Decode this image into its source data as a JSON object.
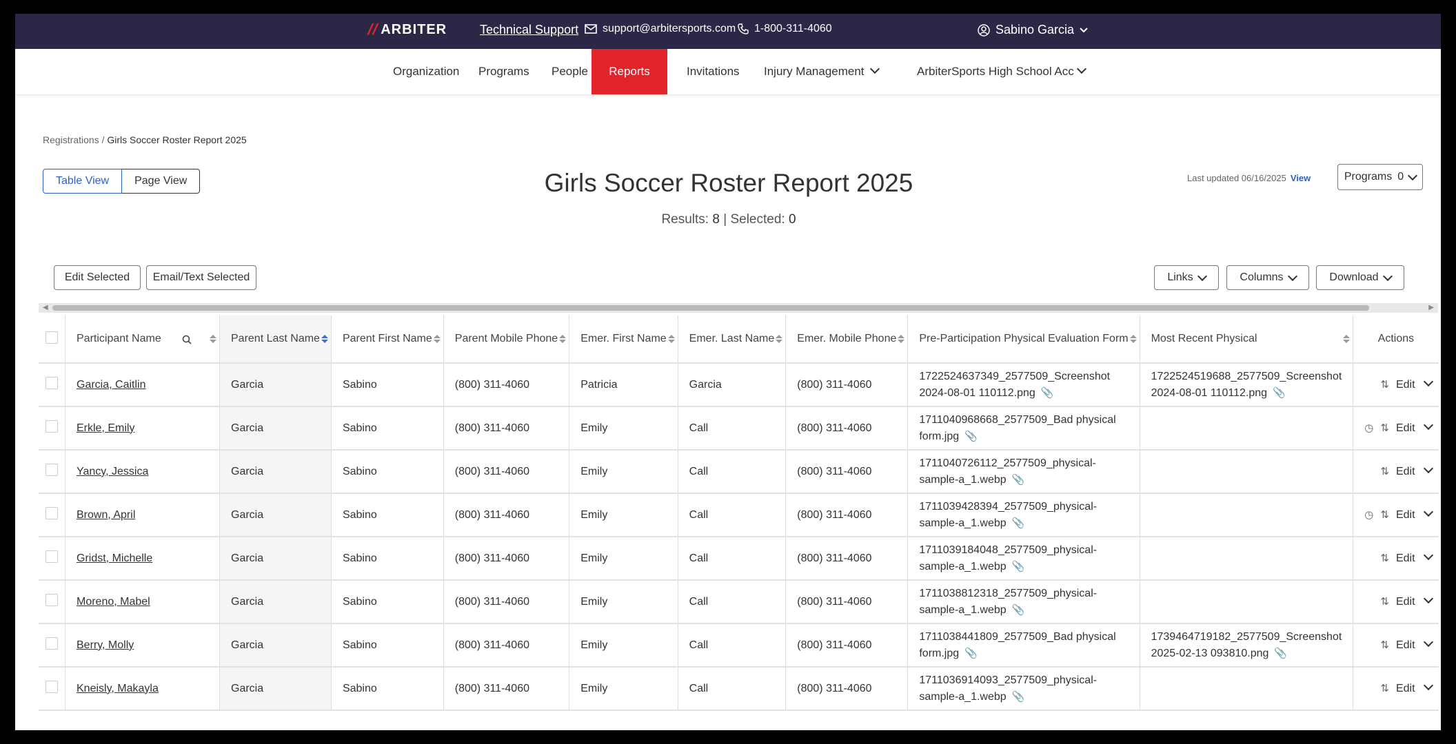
{
  "topbar": {
    "brand": "ARBITER",
    "support_link": "Technical Support",
    "email": "support@arbitersports.com",
    "phone": "1-800-311-4060",
    "user": "Sabino Garcia"
  },
  "nav": {
    "items": [
      "Organization",
      "Programs",
      "People",
      "Reports",
      "Invitations",
      "Injury Management",
      "ArbiterSports High School Acc"
    ],
    "active": "Reports"
  },
  "breadcrumb": {
    "parent": "Registrations",
    "separator": "/",
    "current": "Girls Soccer Roster Report 2025"
  },
  "view_toggle": {
    "table": "Table View",
    "page": "Page View",
    "selected": "Table View"
  },
  "title": "Girls Soccer Roster Report 2025",
  "results": {
    "label": "Results:",
    "count": "8",
    "sep": "|",
    "selected_label": "Selected:",
    "selected_count": "0"
  },
  "last_updated": {
    "text": "Last updated 06/16/2025",
    "link": "View"
  },
  "programs": {
    "label": "Programs",
    "count": "0"
  },
  "toolbar": {
    "edit_selected": "Edit Selected",
    "email_selected": "Email/Text Selected",
    "links": "Links",
    "columns": "Columns",
    "download": "Download"
  },
  "table": {
    "headers": [
      "Participant Name",
      "Parent Last Name",
      "Parent First Name",
      "Parent Mobile Phone",
      "Emer. First Name",
      "Emer. Last Name",
      "Emer. Mobile Phone",
      "Pre-Participation Physical Evaluation Form",
      "Most Recent Physical",
      "Actions"
    ],
    "sorted_column": "Parent Last Name",
    "rows": [
      {
        "name": "Garcia, Caitlin",
        "plast": "Garcia",
        "pfirst": "Sabino",
        "pphone": "(800) 311-4060",
        "efirst": "Patricia",
        "elast": "Garcia",
        "ephone": "(800) 311-4060",
        "ppe_form": "1722524637349_2577509_Screenshot 2024-08-01 110112.png",
        "recent": "1722524519688_2577509_Screenshot 2024-08-01 110112.png",
        "history": false,
        "edit": "Edit"
      },
      {
        "name": "Erkle, Emily",
        "plast": "Garcia",
        "pfirst": "Sabino",
        "pphone": "(800) 311-4060",
        "efirst": "Emily",
        "elast": "Call",
        "ephone": "(800) 311-4060",
        "ppe_form": "1711040968668_2577509_Bad physical form.jpg",
        "recent": "",
        "history": true,
        "edit": "Edit"
      },
      {
        "name": "Yancy, Jessica",
        "plast": "Garcia",
        "pfirst": "Sabino",
        "pphone": "(800) 311-4060",
        "efirst": "Emily",
        "elast": "Call",
        "ephone": "(800) 311-4060",
        "ppe_form": "1711040726112_2577509_physical-sample-a_1.webp",
        "recent": "",
        "history": false,
        "edit": "Edit"
      },
      {
        "name": "Brown, April",
        "plast": "Garcia",
        "pfirst": "Sabino",
        "pphone": "(800) 311-4060",
        "efirst": "Emily",
        "elast": "Call",
        "ephone": "(800) 311-4060",
        "ppe_form": "1711039428394_2577509_physical-sample-a_1.webp",
        "recent": "",
        "history": true,
        "edit": "Edit"
      },
      {
        "name": "Gridst, Michelle",
        "plast": "Garcia",
        "pfirst": "Sabino",
        "pphone": "(800) 311-4060",
        "efirst": "Emily",
        "elast": "Call",
        "ephone": "(800) 311-4060",
        "ppe_form": "1711039184048_2577509_physical-sample-a_1.webp",
        "recent": "",
        "history": false,
        "edit": "Edit"
      },
      {
        "name": "Moreno, Mabel",
        "plast": "Garcia",
        "pfirst": "Sabino",
        "pphone": "(800) 311-4060",
        "efirst": "Emily",
        "elast": "Call",
        "ephone": "(800) 311-4060",
        "ppe_form": "1711038812318_2577509_physical-sample-a_1.webp",
        "recent": "",
        "history": false,
        "edit": "Edit"
      },
      {
        "name": "Berry, Molly",
        "plast": "Garcia",
        "pfirst": "Sabino",
        "pphone": "(800) 311-4060",
        "efirst": "Emily",
        "elast": "Call",
        "ephone": "(800) 311-4060",
        "ppe_form": "1711038441809_2577509_Bad physical form.jpg",
        "recent": "1739464719182_2577509_Screenshot 2025-02-13 093810.png",
        "history": false,
        "edit": "Edit"
      },
      {
        "name": "Kneisly, Makayla",
        "plast": "Garcia",
        "pfirst": "Sabino",
        "pphone": "(800) 311-4060",
        "efirst": "Emily",
        "elast": "Call",
        "ephone": "(800) 311-4060",
        "ppe_form": "1711036914093_2577509_physical-sample-a_1.webp",
        "recent": "",
        "history": false,
        "edit": "Edit"
      }
    ]
  },
  "colors": {
    "brand_dark": "#2a2747",
    "accent_red": "#e0242a",
    "link_blue": "#2d5fc7"
  },
  "icons": {
    "mail": "mail-icon",
    "phone": "phone-icon",
    "user": "user-circle-icon",
    "search": "search-icon",
    "clip": "paperclip-icon",
    "history": "history-icon",
    "transfer": "transfer-icon"
  }
}
